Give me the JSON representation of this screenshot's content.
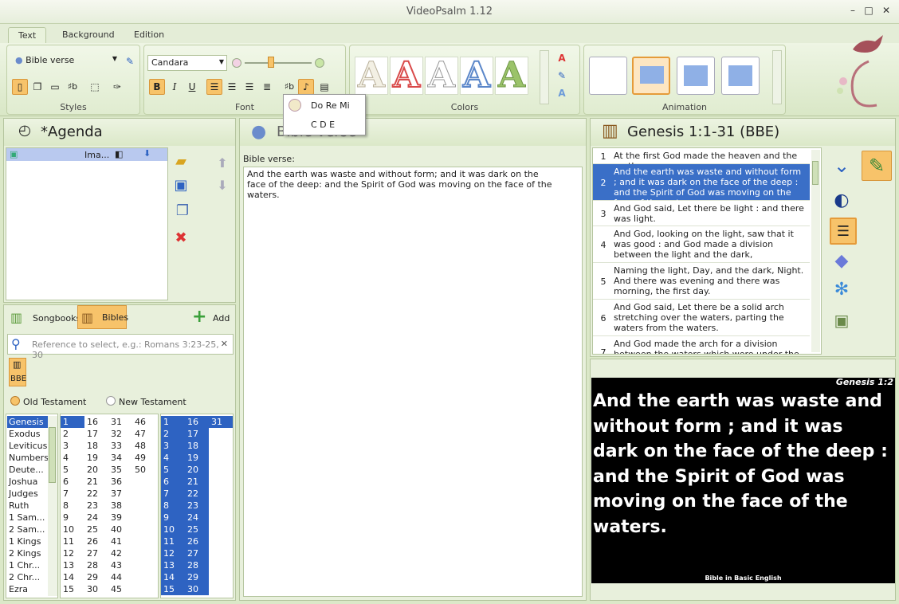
{
  "window": {
    "title": "VideoPsalm 1.12",
    "min": "–",
    "max": "□",
    "close": "✕"
  },
  "tabs": [
    "Text",
    "Background",
    "Edition"
  ],
  "ribbon": {
    "style_combo": "Bible verse",
    "font_combo": "Candara",
    "groups": {
      "styles": "Styles",
      "font": "Font",
      "colors": "Colors",
      "animation": "Animation"
    },
    "bold": "B",
    "italic": "I",
    "underline": "U",
    "chords": "♯b",
    "letter_a": "A"
  },
  "dropdown": {
    "items": [
      "Do Re Mi",
      "C D E"
    ]
  },
  "agenda": {
    "title": "*Agenda",
    "item_label": "Ima..."
  },
  "library": {
    "tabs": {
      "songbooks": "Songbooks",
      "bibles": "Bibles",
      "add": "Add"
    },
    "search_placeholder": "Reference to select, e.g.: Romans 3:23-25, 30",
    "search_clear": "✕",
    "bible_badge": "BBE",
    "testaments": {
      "old": "Old Testament",
      "new": "New Testament"
    },
    "books": [
      "Genesis",
      "Exodus",
      "Leviticus",
      "Numbers",
      "Deute...",
      "Joshua",
      "Judges",
      "Ruth",
      "1 Sam...",
      "2 Sam...",
      "1 Kings",
      "2 Kings",
      "1 Chr...",
      "2 Chr...",
      "Ezra"
    ],
    "chapters": [
      [
        "1",
        "2",
        "3",
        "4",
        "5",
        "6",
        "7",
        "8",
        "9",
        "10",
        "11",
        "12",
        "13",
        "14",
        "15"
      ],
      [
        "16",
        "17",
        "18",
        "19",
        "20",
        "21",
        "22",
        "23",
        "24",
        "25",
        "26",
        "27",
        "28",
        "29",
        "30"
      ],
      [
        "31",
        "32",
        "33",
        "34",
        "35",
        "36",
        "37",
        "38",
        "39",
        "40",
        "41",
        "42",
        "43",
        "44",
        "45"
      ],
      [
        "46",
        "47",
        "48",
        "49",
        "50"
      ]
    ],
    "verses": [
      [
        "1",
        "2",
        "3",
        "4",
        "5",
        "6",
        "7",
        "8",
        "9",
        "10",
        "11",
        "12",
        "13",
        "14",
        "15"
      ],
      [
        "16",
        "17",
        "18",
        "19",
        "20",
        "21",
        "22",
        "23",
        "24",
        "25",
        "26",
        "27",
        "28",
        "29",
        "30"
      ],
      [
        "31"
      ]
    ]
  },
  "editor": {
    "title": "Bible verse",
    "label": "Bible verse:",
    "text": "And the earth was waste and without form; and it was dark on the face of the deep: and the Spirit of God was moving on the face of the waters."
  },
  "passage": {
    "title": "Genesis 1:1-31 (BBE)",
    "verses": [
      {
        "n": "1",
        "text": "At the first God made the heaven and the earth."
      },
      {
        "n": "2",
        "text": "And the earth was waste and without form ; and it was dark on the face of the deep : and the Spirit of God was moving on the face of the waters."
      },
      {
        "n": "3",
        "text": "And God said, Let there be light : and there was light."
      },
      {
        "n": "4",
        "text": "And God, looking on the light, saw that it was good : and God made a division between the light and the dark,"
      },
      {
        "n": "5",
        "text": "Naming the light, Day, and the dark, Night. And there was evening and there was morning, the first day."
      },
      {
        "n": "6",
        "text": "And God said, Let there be a solid arch stretching over the waters, parting the waters from the waters."
      },
      {
        "n": "7",
        "text": "And God made the arch for a division between the waters which were under the arch and those"
      }
    ]
  },
  "preview": {
    "reference": "Genesis 1:2",
    "text": "And the earth was waste and without form ; and it was dark on the face of the deep : and the Spirit of God was moving on the face of the waters.",
    "caption": "Bible in Basic English"
  },
  "colors": {
    "accent_orange": "#f7c36a",
    "selection_blue": "#3a6fc7",
    "panel_green": "#e8f0dc"
  }
}
